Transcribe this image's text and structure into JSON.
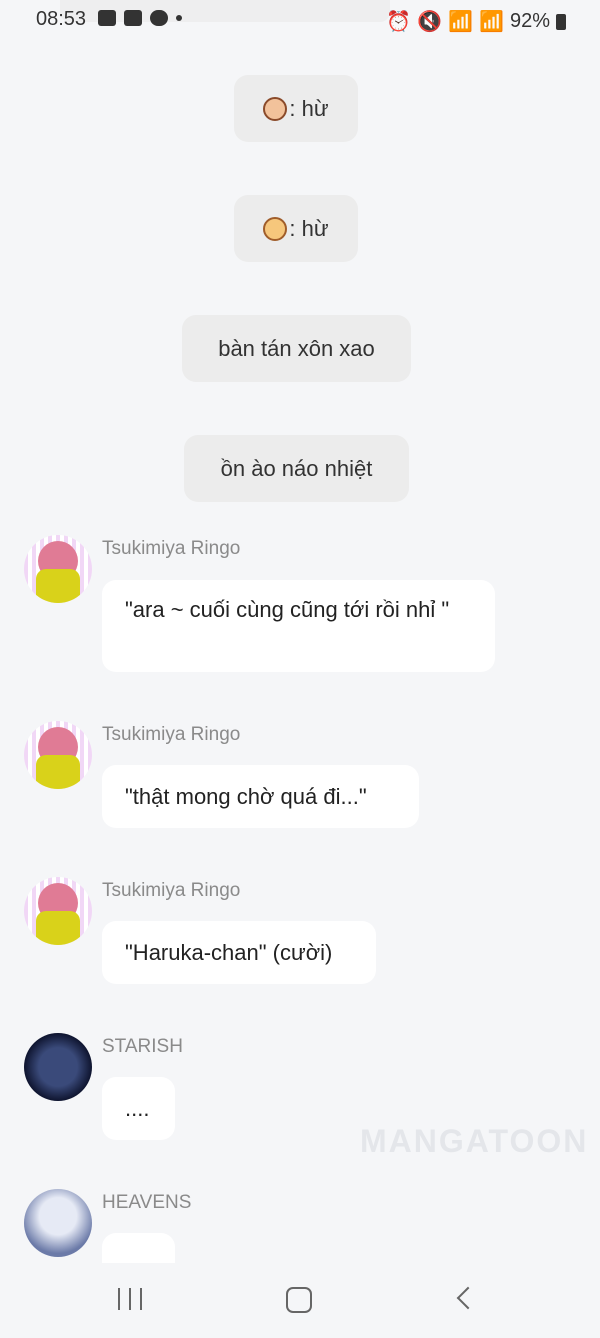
{
  "status_bar": {
    "time": "08:53",
    "battery": "92%"
  },
  "narration": [
    {
      "text": ": hừ"
    },
    {
      "text": ": hừ"
    },
    {
      "text": "bàn tán xôn xao"
    },
    {
      "text": "ồn ào náo nhiệt"
    }
  ],
  "messages": [
    {
      "sender": "Tsukimiya Ringo",
      "text": "\"ara ~ cuối cùng cũng tới rồi nhỉ \""
    },
    {
      "sender": "Tsukimiya Ringo",
      "text": "\"thật mong chờ quá đi...\""
    },
    {
      "sender": "Tsukimiya Ringo",
      "text": "\"Haruka-chan\" (cười)"
    },
    {
      "sender": "STARISH",
      "text": "...."
    },
    {
      "sender": "HEAVENS",
      "text": ""
    }
  ],
  "watermark": "MANGATOON"
}
